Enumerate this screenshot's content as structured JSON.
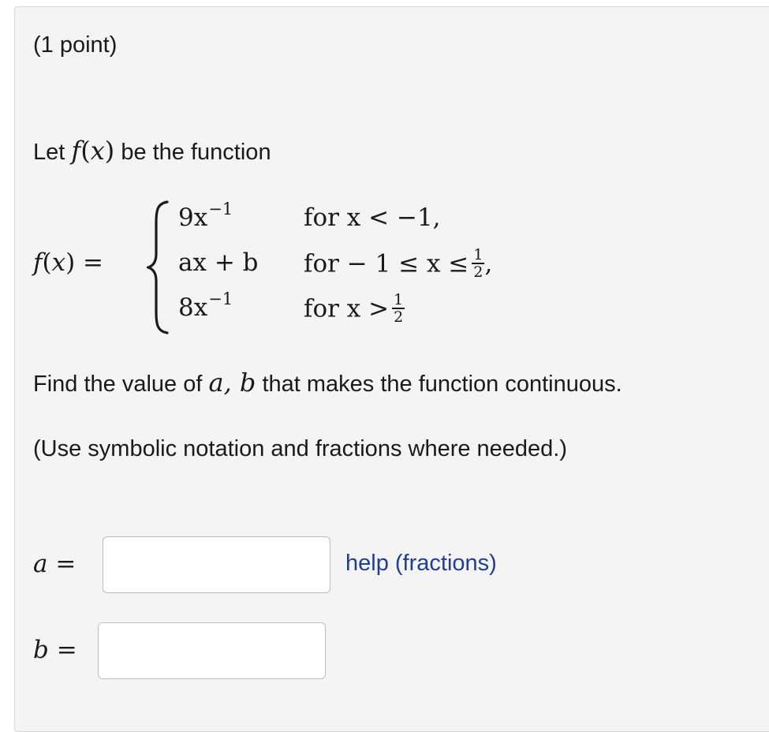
{
  "problem": {
    "points": "(1 point)",
    "intro": {
      "before": "Let",
      "after": "be the function"
    },
    "definition_lhs": "f(x) =",
    "cases": [
      {
        "expr_base": "9x",
        "expr_exp": "−1",
        "cond": "for x < −1,"
      },
      {
        "expr_base": "ax + b",
        "expr_exp": "",
        "cond": "for  − 1 ≤ x ≤"
      },
      {
        "expr_base": "8x",
        "expr_exp": "−1",
        "cond": "for x >"
      }
    ],
    "fraction": {
      "num": "1",
      "den": "2"
    },
    "question": {
      "before": "Find the value of",
      "vars": "a, b",
      "after": "that makes the function continuous."
    },
    "note": "(Use symbolic notation and fractions where needed.)"
  },
  "answers": [
    {
      "label_var": "a",
      "label_eq": "=",
      "value": "",
      "placeholder": ""
    },
    {
      "label_var": "b",
      "label_eq": "=",
      "value": "",
      "placeholder": ""
    }
  ],
  "help_link": "help (fractions)",
  "colors": {
    "panel_bg": "#f4f4f4",
    "link": "#1f3d99",
    "input_border": "#bdbdbd"
  }
}
